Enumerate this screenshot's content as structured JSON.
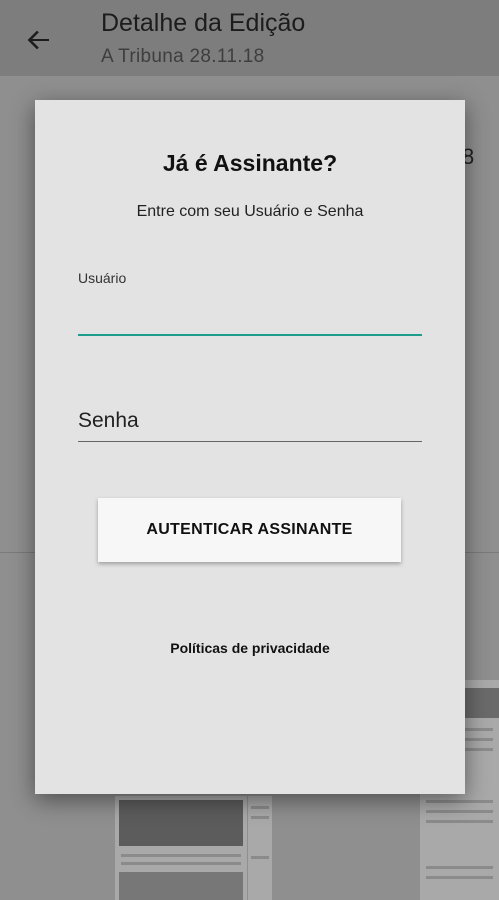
{
  "appbar": {
    "title": "Detalhe da Edição",
    "subtitle": "A Tribuna 28.11.18",
    "back_icon": "arrow-back-icon",
    "peek_text": "8"
  },
  "dialog": {
    "title": "Já é Assinante?",
    "subtitle": "Entre com seu Usuário e Senha",
    "username": {
      "label": "Usuário",
      "value": "",
      "accent_color": "#1f9d8c"
    },
    "password": {
      "placeholder": "Senha",
      "value": ""
    },
    "auth_button": "AUTENTICAR ASSINANTE",
    "privacy_link": "Políticas de privacidade"
  }
}
